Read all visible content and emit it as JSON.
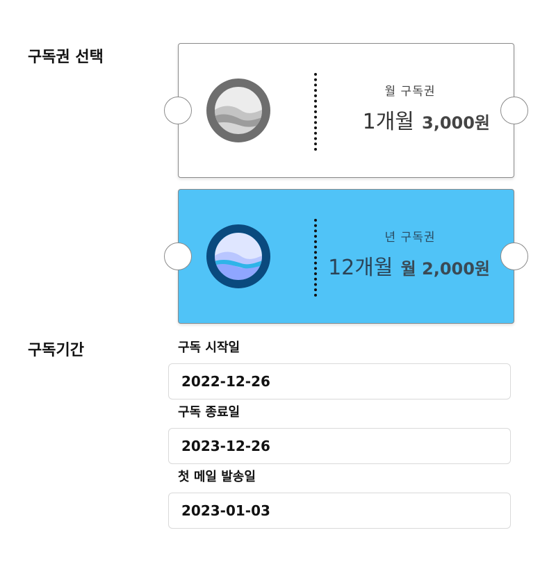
{
  "plan_section": {
    "label": "구독권 선택",
    "tickets": [
      {
        "name": "월 구독권",
        "duration": "1개월",
        "price": "3,000원",
        "background_color": "#ffffff",
        "icon_ring_color": "#6e6e6e",
        "icon": "wave-ring-icon",
        "selected": false
      },
      {
        "name": "년 구독권",
        "duration": "12개월",
        "price": "월 2,000원",
        "background_color": "#50c3f7",
        "icon_ring_color": "#0a4a7e",
        "icon": "wave-ring-icon",
        "selected": true
      }
    ]
  },
  "period_section": {
    "label": "구독기간",
    "start": {
      "label": "구독 시작일",
      "value": "2022-12-26"
    },
    "end": {
      "label": "구독 종료일",
      "value": "2023-12-26"
    },
    "first_mail": {
      "label": "첫 메일 발송일",
      "value": "2023-01-03"
    }
  }
}
